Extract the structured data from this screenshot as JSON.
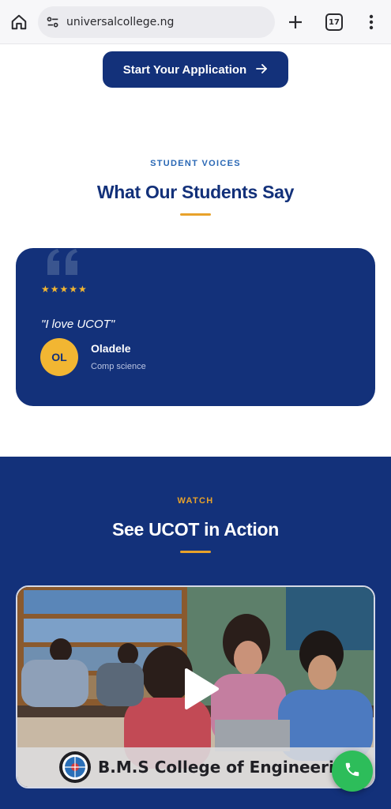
{
  "browser": {
    "url": "universalcollege.ng",
    "tab_count": "17"
  },
  "cta": {
    "label": "Start Your Application"
  },
  "student_voices": {
    "eyebrow": "STUDENT VOICES",
    "heading": "What Our Students Say",
    "testimonial": {
      "rating": 5,
      "stars": "★★★★★",
      "quote": "\"I love UCOT\"",
      "initials": "OL",
      "name": "Oladele",
      "department": "Comp science"
    }
  },
  "watch": {
    "eyebrow": "WATCH",
    "heading": "See UCOT in Action",
    "video": {
      "caption": "B.M.S College of Engineering"
    }
  },
  "colors": {
    "navy": "#13317a",
    "gold": "#e8a22a",
    "star": "#f2b632",
    "call_green": "#2dbd5a"
  },
  "icons": [
    "home-icon",
    "site-settings-icon",
    "plus-icon",
    "tab-switcher-icon",
    "kebab-menu-icon",
    "arrow-right-icon",
    "quote-icon",
    "play-icon",
    "college-logo",
    "phone-icon"
  ]
}
